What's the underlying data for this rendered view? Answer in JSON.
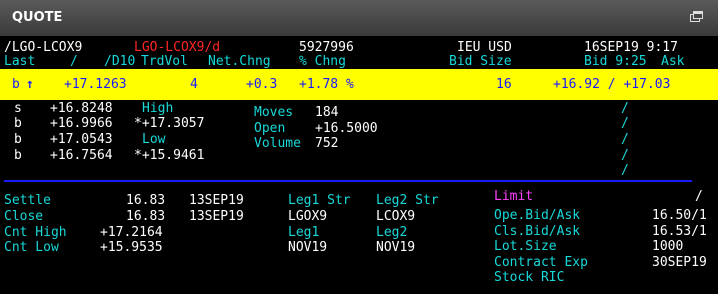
{
  "window": {
    "title": "QUOTE"
  },
  "header": {
    "ric": "/LGO-LCOX9",
    "chain": "LGO-LCOX9/d",
    "code": "5927996",
    "exchange_ccy": "IEU USD",
    "datetime": "16SEP19 9:17"
  },
  "columns": {
    "last": "Last",
    "slash1": "/",
    "d10": "/D10",
    "trdvol": "TrdVol",
    "netchng": "Net.Chng",
    "pctchng": "% Chng",
    "bidsize": "Bid Size",
    "bidtime": "Bid 9:25",
    "ask": "Ask"
  },
  "quote": {
    "tick": "b",
    "arrow": "↑",
    "last": "+17.1263",
    "trdvol": "4",
    "netchng": "+0.3",
    "pctchng": "+1.78 %",
    "bidsize": "16",
    "bidask": "+16.92 / +17.03"
  },
  "trades": [
    {
      "type": "s",
      "price": "+16.8248"
    },
    {
      "type": "b",
      "price": "+16.9966"
    },
    {
      "type": "b",
      "price": "+17.0543"
    },
    {
      "type": "b",
      "price": "+16.7564"
    }
  ],
  "highlow": {
    "high_label": "High",
    "high": "*+17.3057",
    "low_label": "Low",
    "low": "*+15.9461"
  },
  "stats": {
    "moves_label": "Moves",
    "moves": "184",
    "open_label": "Open",
    "open": "+16.5000",
    "volume_label": "Volume",
    "volume": "752"
  },
  "slashes": [
    "/",
    "/",
    "/",
    "/",
    "/"
  ],
  "bottom": {
    "settle_label": "Settle",
    "settle": "16.83",
    "settle_date": "13SEP19",
    "close_label": "Close",
    "close": "16.83",
    "close_date": "13SEP19",
    "cnt_high_label": "Cnt High",
    "cnt_high": "+17.2164",
    "cnt_low_label": "Cnt Low",
    "cnt_low": "+15.9535"
  },
  "legs": {
    "leg1_str_label": "Leg1 Str",
    "leg1_str": "LGOX9",
    "leg2_str_label": "Leg2 Str",
    "leg2_str": "LCOX9",
    "leg1_label": "Leg1",
    "leg1": "NOV19",
    "leg2_label": "Leg2",
    "leg2": "NOV19"
  },
  "limits": {
    "limit_label": "Limit",
    "limit_value": "/",
    "ope_label": "Ope.Bid/Ask",
    "ope_value": "16.50/1",
    "cls_label": "Cls.Bid/Ask",
    "cls_value": "16.53/1",
    "lot_label": "Lot.Size",
    "lot_value": "1000",
    "exp_label": "Contract Exp",
    "exp_value": "30SEP19",
    "ric_label": "Stock RIC"
  }
}
